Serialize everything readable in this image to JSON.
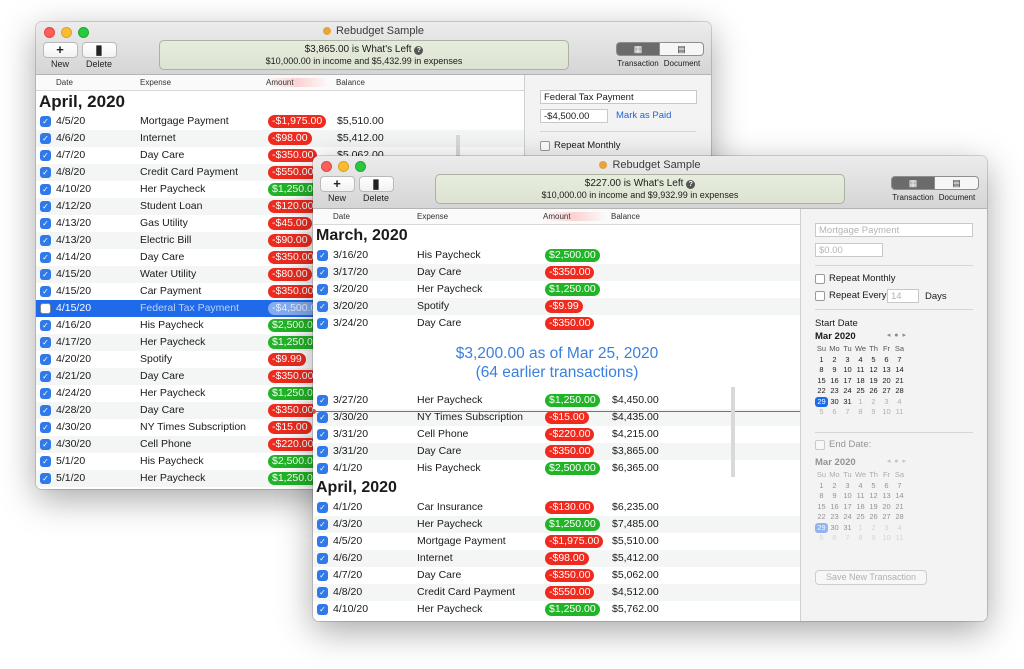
{
  "back_window": {
    "title": "Rebudget Sample",
    "toolbar": {
      "new_label": "New",
      "delete_label": "Delete",
      "new_icon": "+",
      "delete_icon": "trash-icon"
    },
    "summary": {
      "headline": "$3,865.00 is What's Left",
      "detail": "$10,000.00 in income and $5,432.99 in expenses"
    },
    "view_toggle": {
      "transaction_label": "Transaction",
      "document_label": "Document"
    },
    "columns": {
      "date": "Date",
      "expense": "Expense",
      "amount": "Amount",
      "balance": "Balance"
    },
    "month": "April, 2020",
    "rows": [
      {
        "date": "4/5/20",
        "expense": "Mortgage Payment",
        "amount": "-$1,975.00",
        "balance": "$5,510.00"
      },
      {
        "date": "4/6/20",
        "expense": "Internet",
        "amount": "-$98.00",
        "balance": "$5,412.00"
      },
      {
        "date": "4/7/20",
        "expense": "Day Care",
        "amount": "-$350.00",
        "balance": "$5,062.00"
      },
      {
        "date": "4/8/20",
        "expense": "Credit Card Payment",
        "amount": "-$550.00",
        "balance": ""
      },
      {
        "date": "4/10/20",
        "expense": "Her Paycheck",
        "amount": "$1,250.00",
        "balance": ""
      },
      {
        "date": "4/12/20",
        "expense": "Student Loan",
        "amount": "-$120.00",
        "balance": ""
      },
      {
        "date": "4/13/20",
        "expense": "Gas Utility",
        "amount": "-$45.00",
        "balance": ""
      },
      {
        "date": "4/13/20",
        "expense": "Electric Bill",
        "amount": "-$90.00",
        "balance": ""
      },
      {
        "date": "4/14/20",
        "expense": "Day Care",
        "amount": "-$350.00",
        "balance": ""
      },
      {
        "date": "4/15/20",
        "expense": "Water Utility",
        "amount": "-$80.00",
        "balance": ""
      },
      {
        "date": "4/15/20",
        "expense": "Car Payment",
        "amount": "-$350.00",
        "balance": ""
      },
      {
        "date": "4/15/20",
        "expense": "Federal Tax Payment",
        "amount": "-$4,500.00",
        "balance": ""
      },
      {
        "date": "4/16/20",
        "expense": "His Paycheck",
        "amount": "$2,500.00",
        "balance": ""
      },
      {
        "date": "4/17/20",
        "expense": "Her Paycheck",
        "amount": "$1,250.00",
        "balance": ""
      },
      {
        "date": "4/20/20",
        "expense": "Spotify",
        "amount": "-$9.99",
        "balance": ""
      },
      {
        "date": "4/21/20",
        "expense": "Day Care",
        "amount": "-$350.00",
        "balance": ""
      },
      {
        "date": "4/24/20",
        "expense": "Her Paycheck",
        "amount": "$1,250.00",
        "balance": ""
      },
      {
        "date": "4/28/20",
        "expense": "Day Care",
        "amount": "-$350.00",
        "balance": ""
      },
      {
        "date": "4/30/20",
        "expense": "NY Times Subscription",
        "amount": "-$15.00",
        "balance": ""
      },
      {
        "date": "4/30/20",
        "expense": "Cell Phone",
        "amount": "-$220.00",
        "balance": ""
      },
      {
        "date": "5/1/20",
        "expense": "His Paycheck",
        "amount": "$2,500.00",
        "balance": ""
      },
      {
        "date": "5/1/20",
        "expense": "Her Paycheck",
        "amount": "$1,250.00",
        "balance": ""
      }
    ],
    "selected_row": 11,
    "detail": {
      "name": "Federal Tax Payment",
      "amount": "-$4,500.00",
      "mark_paid": "Mark as Paid",
      "repeat_monthly": "Repeat Monthly"
    }
  },
  "front_window": {
    "title": "Rebudget Sample",
    "toolbar": {
      "new_label": "New",
      "delete_label": "Delete",
      "new_icon": "+",
      "delete_icon": "trash-icon"
    },
    "summary": {
      "headline": "$227.00 is What's Left",
      "detail": "$10,000.00 in income and $9,932.99 in expenses"
    },
    "view_toggle": {
      "transaction_label": "Transaction",
      "document_label": "Document"
    },
    "columns": {
      "date": "Date",
      "expense": "Expense",
      "amount": "Amount",
      "balance": "Balance"
    },
    "march_title": "March, 2020",
    "march_rows": [
      {
        "date": "3/16/20",
        "expense": "His Paycheck",
        "amount": "$2,500.00",
        "balance": ""
      },
      {
        "date": "3/17/20",
        "expense": "Day Care",
        "amount": "-$350.00",
        "balance": ""
      },
      {
        "date": "3/20/20",
        "expense": "Her Paycheck",
        "amount": "$1,250.00",
        "balance": ""
      },
      {
        "date": "3/20/20",
        "expense": "Spotify",
        "amount": "-$9.99",
        "balance": ""
      },
      {
        "date": "3/24/20",
        "expense": "Day Care",
        "amount": "-$350.00",
        "balance": ""
      }
    ],
    "as_of_line1": "$3,200.00 as of Mar 25, 2020",
    "as_of_line2": "(64 earlier transactions)",
    "after_rows": [
      {
        "date": "3/27/20",
        "expense": "Her Paycheck",
        "amount": "$1,250.00",
        "balance": "$4,450.00"
      },
      {
        "date": "3/30/20",
        "expense": "NY Times Subscription",
        "amount": "-$15.00",
        "balance": "$4,435.00"
      },
      {
        "date": "3/31/20",
        "expense": "Cell Phone",
        "amount": "-$220.00",
        "balance": "$4,215.00"
      },
      {
        "date": "3/31/20",
        "expense": "Day Care",
        "amount": "-$350.00",
        "balance": "$3,865.00"
      },
      {
        "date": "4/1/20",
        "expense": "His Paycheck",
        "amount": "$2,500.00",
        "balance": "$6,365.00"
      }
    ],
    "april_title": "April, 2020",
    "april_rows": [
      {
        "date": "4/1/20",
        "expense": "Car Insurance",
        "amount": "-$130.00",
        "balance": "$6,235.00"
      },
      {
        "date": "4/3/20",
        "expense": "Her Paycheck",
        "amount": "$1,250.00",
        "balance": "$7,485.00"
      },
      {
        "date": "4/5/20",
        "expense": "Mortgage Payment",
        "amount": "-$1,975.00",
        "balance": "$5,510.00"
      },
      {
        "date": "4/6/20",
        "expense": "Internet",
        "amount": "-$98.00",
        "balance": "$5,412.00"
      },
      {
        "date": "4/7/20",
        "expense": "Day Care",
        "amount": "-$350.00",
        "balance": "$5,062.00"
      },
      {
        "date": "4/8/20",
        "expense": "Credit Card Payment",
        "amount": "-$550.00",
        "balance": "$4,512.00"
      },
      {
        "date": "4/10/20",
        "expense": "Her Paycheck",
        "amount": "$1,250.00",
        "balance": "$5,762.00"
      }
    ],
    "detail": {
      "name_placeholder": "Mortgage Payment",
      "amount_placeholder": "$0.00",
      "repeat_monthly": "Repeat Monthly",
      "repeat_every": "Repeat Every",
      "repeat_every_value": "14",
      "days": "Days",
      "start_date": "Start Date",
      "end_date": "End Date:",
      "save": "Save New Transaction"
    },
    "calendar": {
      "month": "Mar 2020",
      "nav": "◂ ● ▸",
      "weekdays": [
        "Su",
        "Mo",
        "Tu",
        "We",
        "Th",
        "Fr",
        "Sa"
      ],
      "weeks": [
        [
          "1",
          "2",
          "3",
          "4",
          "5",
          "6",
          "7"
        ],
        [
          "8",
          "9",
          "10",
          "11",
          "12",
          "13",
          "14"
        ],
        [
          "15",
          "16",
          "17",
          "18",
          "19",
          "20",
          "21"
        ],
        [
          "22",
          "23",
          "24",
          "25",
          "26",
          "27",
          "28"
        ],
        [
          "29",
          "30",
          "31",
          "1",
          "2",
          "3",
          "4"
        ],
        [
          "5",
          "6",
          "7",
          "8",
          "9",
          "10",
          "11"
        ]
      ],
      "today": "29"
    }
  }
}
